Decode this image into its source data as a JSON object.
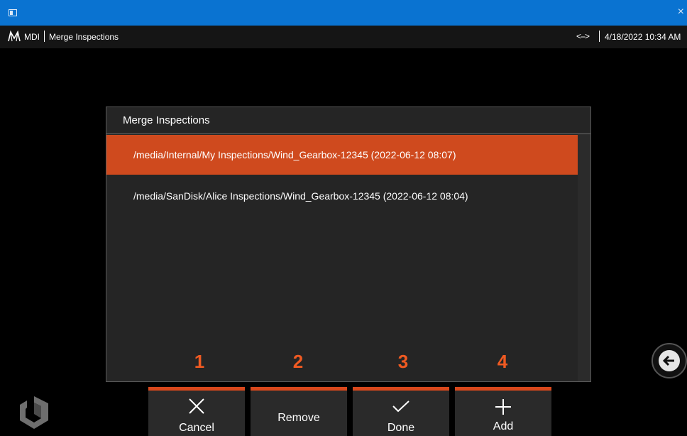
{
  "window": {
    "close_glyph": "×"
  },
  "appbar": {
    "brand": "MDI",
    "breadcrumb": "Merge Inspections",
    "link_glyph": "<-->",
    "datetime": "4/18/2022 10:34 AM"
  },
  "dialog": {
    "title": "Merge Inspections",
    "items": [
      {
        "label": "/media/Internal/My Inspections/Wind_Gearbox-12345 (2022-06-12 08:07)",
        "selected": true
      },
      {
        "label": "/media/SanDisk/Alice Inspections/Wind_Gearbox-12345 (2022-06-12 08:04)",
        "selected": false
      }
    ],
    "callout_numbers": [
      "1",
      "2",
      "3",
      "4"
    ]
  },
  "buttons": {
    "cancel": {
      "label": "Cancel",
      "icon": "close-icon"
    },
    "remove": {
      "label": "Remove"
    },
    "done": {
      "label": "Done",
      "icon": "check-icon"
    },
    "add": {
      "label": "Add",
      "icon": "plus-icon"
    }
  },
  "colors": {
    "accent": "#cf4a1e",
    "callout": "#f05a22",
    "titlebar": "#0a73d1",
    "dialog_bg": "#252525"
  }
}
